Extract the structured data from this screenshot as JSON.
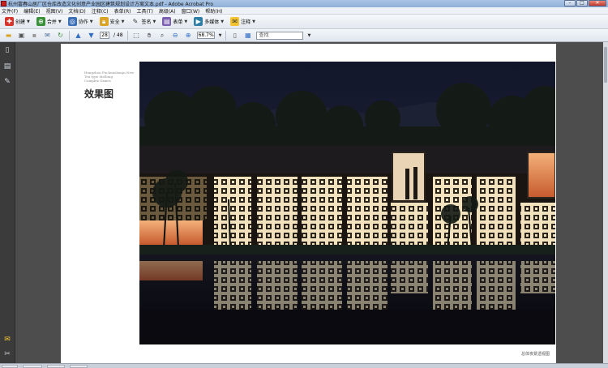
{
  "window": {
    "title": "杭州富春山居厂区仓库改造文化创意产业园区建筑规划设计方案文本.pdf - Adobe Acrobat Pro",
    "controls": {
      "minimize": "–",
      "maximize": "□",
      "close": "✕"
    }
  },
  "menu": [
    "文件(F)",
    "编辑(E)",
    "视图(V)",
    "文档(D)",
    "注释(C)",
    "表单(R)",
    "工具(T)",
    "高级(A)",
    "窗口(W)",
    "帮助(H)"
  ],
  "toolbar": {
    "create": "创建",
    "combine": "合并",
    "collaborate": "协作",
    "secure": "安全",
    "sign": "签名",
    "forms": "表单",
    "multimedia": "多媒体",
    "comment": "注释"
  },
  "nav": {
    "current_page": "28",
    "total_pages": "/ 48",
    "zoom": "68.7%",
    "search_placeholder": "查找"
  },
  "page": {
    "side_small_1": "Hangzhou Fuchunshanju New",
    "side_small_2": "Tea type Mellong",
    "side_small_3": "Complex Games",
    "heading": "效果图",
    "caption": "总体夜景透视图"
  },
  "colors": {
    "sky": "#161a2c",
    "window_glow": "#f4e6c4",
    "water": "#0c0d14",
    "page_bg": "#ffffff",
    "doc_bg": "#4d4d4d"
  }
}
